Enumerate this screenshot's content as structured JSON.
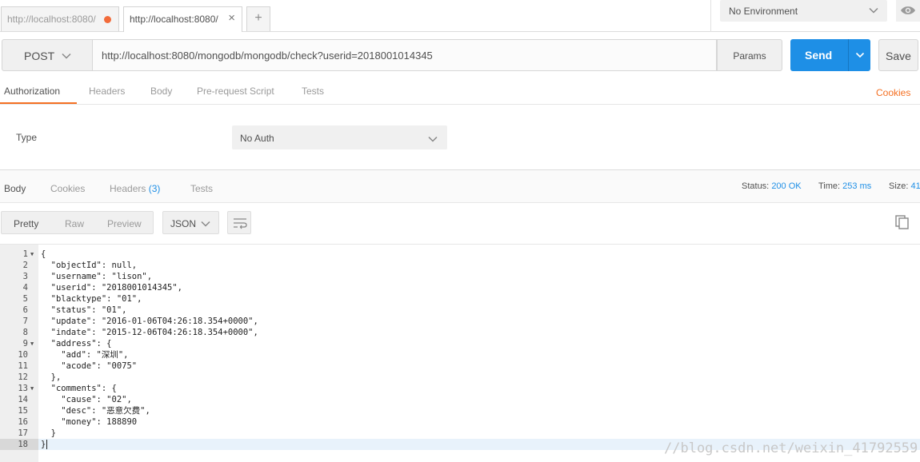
{
  "tabs": [
    {
      "label": "http://localhost:8080/",
      "unsaved": true,
      "active": false
    },
    {
      "label": "http://localhost:8080/",
      "close": "×",
      "active": true
    }
  ],
  "add_tab": "+",
  "environment": {
    "selected": "No Environment"
  },
  "request": {
    "method": "POST",
    "url": "http://localhost:8080/mongodb/mongodb/check?userid=2018001014345",
    "params_label": "Params",
    "send_label": "Send",
    "save_label": "Save"
  },
  "request_tabs": [
    "Authorization",
    "Headers",
    "Body",
    "Pre-request Script",
    "Tests"
  ],
  "cookies_link": "Cookies",
  "auth": {
    "type_label": "Type",
    "type_value": "No Auth"
  },
  "response_tabs": {
    "body": "Body",
    "cookies": "Cookies",
    "headers": "Headers",
    "headers_count": "(3)",
    "tests": "Tests"
  },
  "response_meta": {
    "status_label": "Status:",
    "status_value": "200 OK",
    "time_label": "Time:",
    "time_value": "253 ms",
    "size_label": "Size:",
    "size_value": "41"
  },
  "view_modes": [
    "Pretty",
    "Raw",
    "Preview"
  ],
  "format": "JSON",
  "code_lines": [
    "{",
    "  \"objectId\": null,",
    "  \"username\": \"lison\",",
    "  \"userid\": \"2018001014345\",",
    "  \"blacktype\": \"01\",",
    "  \"status\": \"01\",",
    "  \"update\": \"2016-01-06T04:26:18.354+0000\",",
    "  \"indate\": \"2015-12-06T04:26:18.354+0000\",",
    "  \"address\": {",
    "    \"add\": \"深圳\",",
    "    \"acode\": \"0075\"",
    "  },",
    "  \"comments\": {",
    "    \"cause\": \"02\",",
    "    \"desc\": \"恶意欠费\",",
    "    \"money\": 188890",
    "  }",
    "}"
  ],
  "fold_lines": [
    1,
    9,
    13
  ],
  "current_line": 18,
  "watermark": "//blog.csdn.net/weixin_41792559",
  "colors": {
    "accent_orange": "#f47023",
    "send_blue": "#1e8fe6",
    "status_blue": "#1e8fe6"
  },
  "icons": [
    "unsaved-dot-icon",
    "close-icon",
    "chevron-down-icon",
    "eye-icon",
    "wrap-icon",
    "copy-icon",
    "fold-arrow-icon"
  ]
}
